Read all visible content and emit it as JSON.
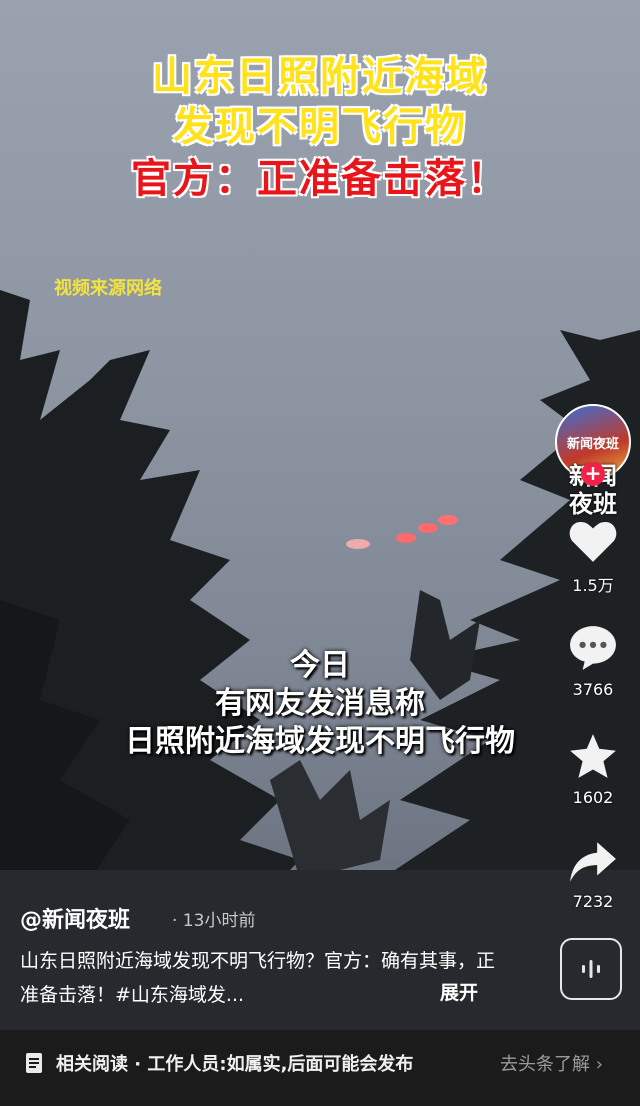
{
  "overlay": {
    "headline_1": "山东日照附近海域",
    "headline_2": "发现不明飞行物",
    "headline_3": "官方：正准备击落！",
    "source_tag": "视频来源网络",
    "subtitle_1": "今日",
    "subtitle_2": "有网友发消息称",
    "subtitle_3": "日照附近海域发现不明飞行物"
  },
  "sidebar": {
    "avatar_text": "新闻夜班",
    "follow_symbol": "+",
    "channel_text_1": "新闻",
    "channel_text_2": "夜班",
    "likes": "1.5万",
    "comments": "3766",
    "favorites": "1602",
    "shares": "7232"
  },
  "post": {
    "author": "@新闻夜班",
    "time": "· 13小时前",
    "description": "山东日照附近海域发现不明飞行物？官方：确有其事，正准备击落！#山东海域发...",
    "expand": "展开"
  },
  "bottom_bar": {
    "related": "相关阅读 · 工作人员:如属实,后面可能会发布",
    "goto": "去头条了解 ›"
  },
  "colors": {
    "headline_yellow": "#ffe21a",
    "headline_red": "#e8161a",
    "light_red": "#ff6a6a"
  },
  "icons": [
    "heart-icon",
    "comment-icon",
    "star-icon",
    "share-icon",
    "sound-wave-icon",
    "doc-icon"
  ]
}
